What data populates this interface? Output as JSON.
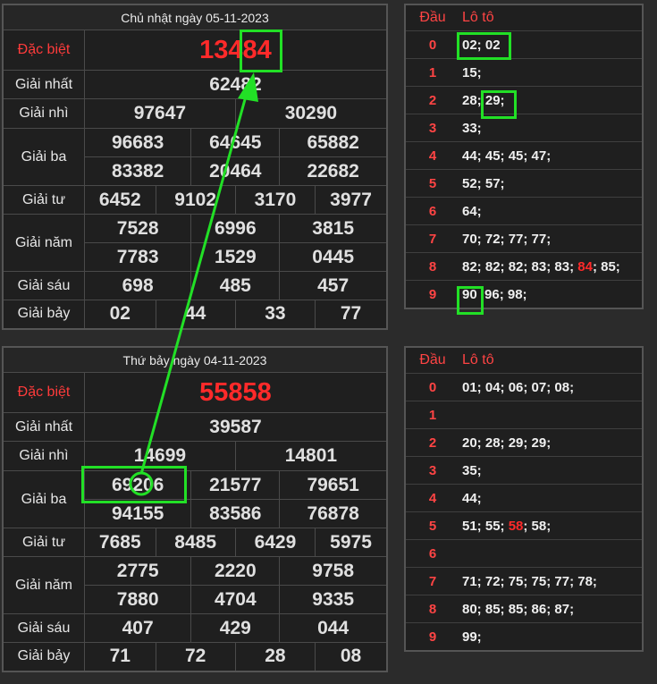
{
  "top": {
    "title": "Chủ nhật ngày 05-11-2023",
    "special_label": "Đặc biệt",
    "special": "13484",
    "first_label": "Giải nhất",
    "first": "62482",
    "second_label": "Giải nhì",
    "second": [
      "97647",
      "30290"
    ],
    "third_label": "Giải ba",
    "third": [
      "96683",
      "64645",
      "65882",
      "83382",
      "20464",
      "22682"
    ],
    "fourth_label": "Giải tư",
    "fourth": [
      "6452",
      "9102",
      "3170",
      "3977"
    ],
    "fifth_label": "Giải năm",
    "fifth": [
      "7528",
      "6996",
      "3815",
      "7783",
      "1529",
      "0445"
    ],
    "sixth_label": "Giải sáu",
    "sixth": [
      "698",
      "485",
      "457"
    ],
    "seventh_label": "Giải bảy",
    "seventh": [
      "02",
      "44",
      "33",
      "77"
    ]
  },
  "bottom": {
    "title": "Thứ bảy ngày 04-11-2023",
    "special_label": "Đặc biệt",
    "special": "55858",
    "first_label": "Giải nhất",
    "first": "39587",
    "second_label": "Giải nhì",
    "second": [
      "14699",
      "14801"
    ],
    "third_label": "Giải ba",
    "third": [
      "69206",
      "21577",
      "79651",
      "94155",
      "83586",
      "76878"
    ],
    "fourth_label": "Giải tư",
    "fourth": [
      "7685",
      "8485",
      "6429",
      "5975"
    ],
    "fifth_label": "Giải năm",
    "fifth": [
      "2775",
      "2220",
      "9758",
      "7880",
      "4704",
      "9335"
    ],
    "sixth_label": "Giải sáu",
    "sixth": [
      "407",
      "429",
      "044"
    ],
    "seventh_label": "Giải bảy",
    "seventh": [
      "71",
      "72",
      "28",
      "08"
    ]
  },
  "loto_top": {
    "dau_header": "Đầu",
    "loto_header": "Lô tô",
    "rows": [
      {
        "dau": "0",
        "pre": "02; 02",
        "red": "",
        "post": ""
      },
      {
        "dau": "1",
        "pre": "15;",
        "red": "",
        "post": ""
      },
      {
        "dau": "2",
        "pre": "28; 29;",
        "red": "",
        "post": ""
      },
      {
        "dau": "3",
        "pre": "33;",
        "red": "",
        "post": ""
      },
      {
        "dau": "4",
        "pre": "44; 45; 45; 47;",
        "red": "",
        "post": ""
      },
      {
        "dau": "5",
        "pre": "52; 57;",
        "red": "",
        "post": ""
      },
      {
        "dau": "6",
        "pre": "64;",
        "red": "",
        "post": ""
      },
      {
        "dau": "7",
        "pre": "70; 72; 77; 77;",
        "red": "",
        "post": ""
      },
      {
        "dau": "8",
        "pre": "82; 82; 82; 83; 83; ",
        "red": "84",
        "post": "; 85;"
      },
      {
        "dau": "9",
        "pre": "90  96; 98;",
        "red": "",
        "post": ""
      }
    ]
  },
  "loto_bottom": {
    "dau_header": "Đầu",
    "loto_header": "Lô tô",
    "rows": [
      {
        "dau": "0",
        "pre": "01; 04; 06; 07; 08;",
        "red": "",
        "post": ""
      },
      {
        "dau": "1",
        "pre": "",
        "red": "",
        "post": ""
      },
      {
        "dau": "2",
        "pre": "20; 28; 29; 29;",
        "red": "",
        "post": ""
      },
      {
        "dau": "3",
        "pre": "35;",
        "red": "",
        "post": ""
      },
      {
        "dau": "4",
        "pre": "44;",
        "red": "",
        "post": ""
      },
      {
        "dau": "5",
        "pre": "51; 55; ",
        "red": "58",
        "post": "; 58;"
      },
      {
        "dau": "6",
        "pre": "",
        "red": "",
        "post": ""
      },
      {
        "dau": "7",
        "pre": "71; 72; 75; 75; 77; 78;",
        "red": "",
        "post": ""
      },
      {
        "dau": "8",
        "pre": "80; 85; 85; 86; 87;",
        "red": "",
        "post": ""
      },
      {
        "dau": "9",
        "pre": "99;",
        "red": "",
        "post": ""
      }
    ]
  },
  "colors": {
    "highlight": "#22e026",
    "special": "#ff2a2a",
    "header_red": "#ff4444"
  }
}
